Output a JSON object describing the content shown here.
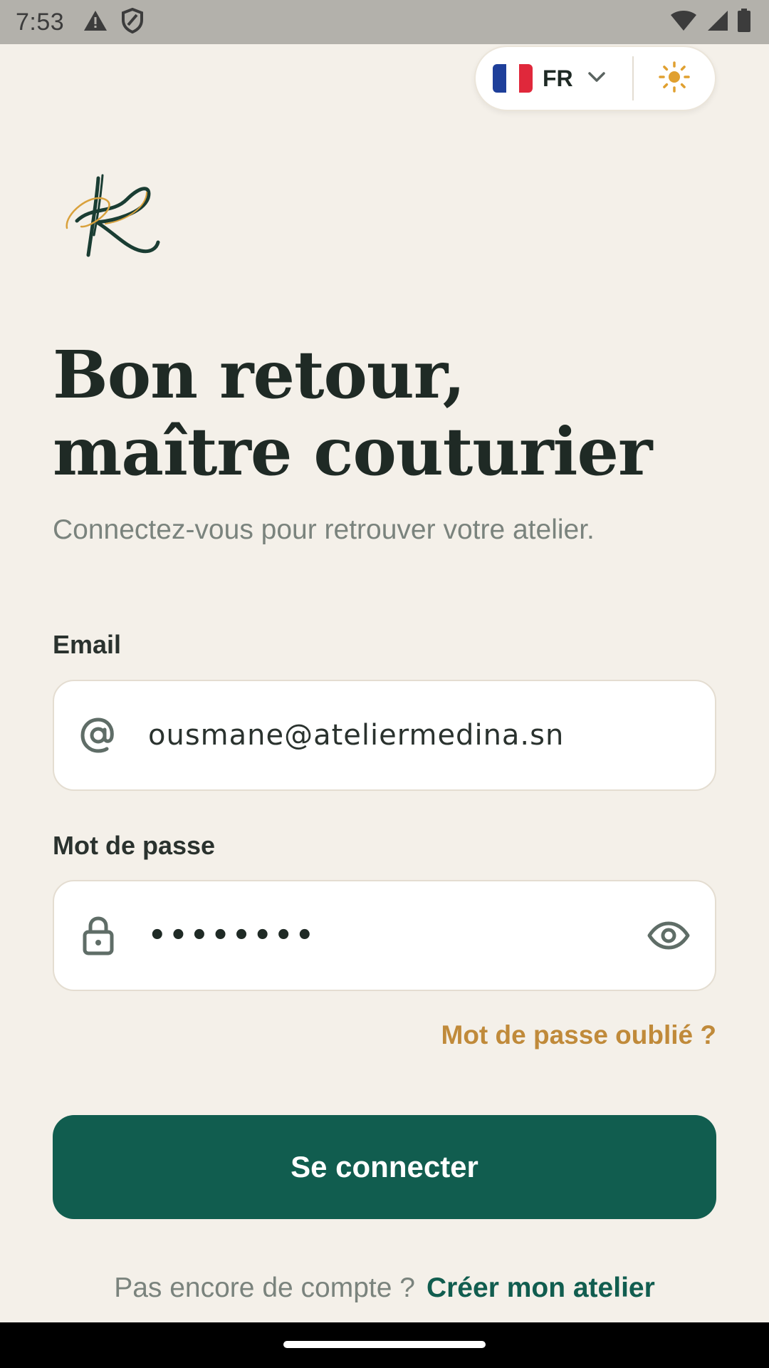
{
  "status_bar": {
    "time": "7:53",
    "left_icons": [
      "warning-icon",
      "shield-icon"
    ],
    "right_icons": [
      "wifi-icon",
      "signal-icon",
      "battery-icon"
    ]
  },
  "top_controls": {
    "language": {
      "code": "FR",
      "flag_colors": [
        "#1e3f9a",
        "#ffffff",
        "#e0283b"
      ]
    },
    "theme_icon": "sun-icon"
  },
  "heading": {
    "line1": "Bon retour,",
    "line2": "maître couturier"
  },
  "subtitle": "Connectez-vous pour retrouver votre atelier.",
  "form": {
    "email": {
      "label": "Email",
      "value": "ousmane@ateliermedina.sn",
      "icon": "at-icon"
    },
    "password": {
      "label": "Mot de passe",
      "masked_value": "••••••••",
      "icon": "lock-icon",
      "toggle_icon": "eye-icon"
    },
    "forgot_password": "Mot de passe oublié ?",
    "submit": "Se connecter"
  },
  "signup": {
    "prompt": "Pas encore de compte ?",
    "link": "Créer mon atelier"
  },
  "colors": {
    "background": "#f4f0e9",
    "primary": "#115d4f",
    "accent": "#c08a3a",
    "text": "#1f2a25",
    "muted": "#7a837d"
  }
}
